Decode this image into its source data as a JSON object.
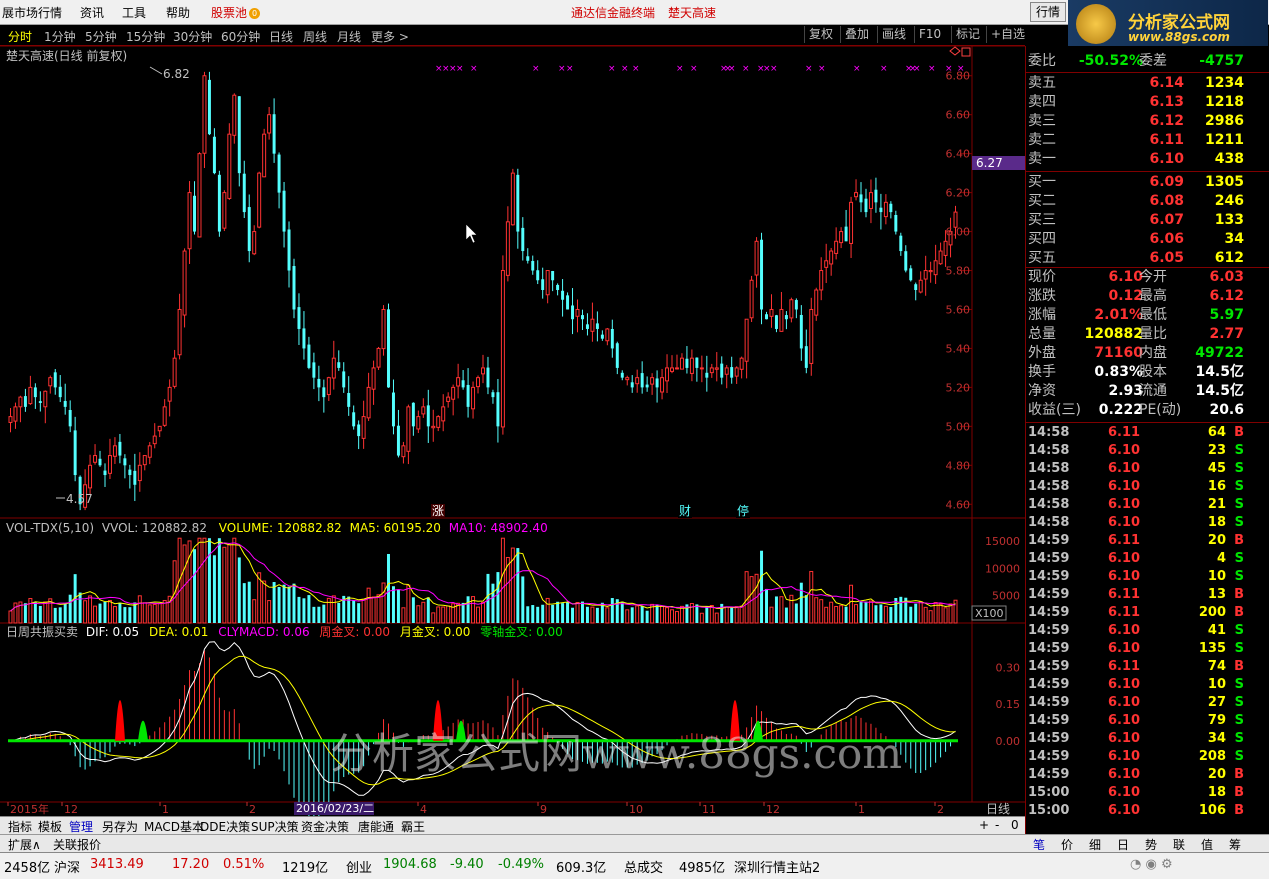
{
  "menu": {
    "items": [
      "展市场行情",
      "资讯",
      "工具",
      "帮助"
    ],
    "pool": "股票池",
    "pool_badge": "0",
    "center_title": "通达信金融终端",
    "stock_name": "楚天高速",
    "quote_button": "行情"
  },
  "logo": {
    "text": "分析家公式网",
    "url": "www.88gs.com"
  },
  "periods": [
    "分时",
    "1分钟",
    "5分钟",
    "15分钟",
    "30分钟",
    "60分钟",
    "日线",
    "周线",
    "月线",
    "更多"
  ],
  "active_period": "分时",
  "toolbar": [
    "复权",
    "叠加",
    "画线",
    "F10",
    "标记",
    "+自选"
  ],
  "main_chart": {
    "title": "楚天高速(日线 前复权)",
    "high_label": "6.82",
    "low_label": "4.57",
    "current_price_tag": "6.27",
    "y_ticks": [
      "6.80",
      "6.60",
      "6.40",
      "6.20",
      "6.00",
      "5.80",
      "5.60",
      "5.40",
      "5.20",
      "5.00",
      "4.80",
      "4.60"
    ],
    "markers": [
      {
        "text": "涨",
        "color": "#ffffff"
      },
      {
        "text": "财",
        "color": "#54ffff"
      },
      {
        "text": "停",
        "color": "#54ffff"
      }
    ]
  },
  "vol_chart": {
    "title": "VOL-TDX(5,10)",
    "vvol": "VVOL: 120882.82",
    "volume": "VOLUME: 120882.82",
    "ma5": "MA5: 60195.20",
    "ma10": "MA10: 48902.40",
    "y_ticks": [
      "15000",
      "10000",
      "5000"
    ],
    "unit": "X100"
  },
  "macd_chart": {
    "title": "日周共振买卖",
    "dif": "DIF: 0.05",
    "dea": "DEA: 0.01",
    "clymacd": "CLYMACD: 0.06",
    "week_cross": "周金叉: 0.00",
    "month_cross": "月金叉: 0.00",
    "zero_cross": "零轴金叉: 0.00",
    "y_ticks": [
      "0.30",
      "0.15",
      "0.00"
    ]
  },
  "date_axis": {
    "labels": [
      "2015年",
      "12",
      "1",
      "2",
      "4",
      "9",
      "10",
      "11",
      "12",
      "1",
      "2"
    ],
    "cursor_date": "2016/02/23/二",
    "period": "日线"
  },
  "order_book": {
    "weibi_label": "委比",
    "weibi": "-50.52%",
    "weicha_label": "委差",
    "weicha": "-4757",
    "asks": [
      {
        "label": "卖五",
        "price": "6.14",
        "vol": "1234"
      },
      {
        "label": "卖四",
        "price": "6.13",
        "vol": "1218"
      },
      {
        "label": "卖三",
        "price": "6.12",
        "vol": "2986"
      },
      {
        "label": "卖二",
        "price": "6.11",
        "vol": "1211"
      },
      {
        "label": "卖一",
        "price": "6.10",
        "vol": "438"
      }
    ],
    "bids": [
      {
        "label": "买一",
        "price": "6.09",
        "vol": "1305"
      },
      {
        "label": "买二",
        "price": "6.08",
        "vol": "246"
      },
      {
        "label": "买三",
        "price": "6.07",
        "vol": "133"
      },
      {
        "label": "买四",
        "price": "6.06",
        "vol": "34"
      },
      {
        "label": "买五",
        "price": "6.05",
        "vol": "612"
      }
    ]
  },
  "quote": [
    {
      "l1": "现价",
      "v1": "6.10",
      "c1": "red",
      "l2": "今开",
      "v2": "6.03",
      "c2": "red"
    },
    {
      "l1": "涨跌",
      "v1": "0.12",
      "c1": "red",
      "l2": "最高",
      "v2": "6.12",
      "c2": "red"
    },
    {
      "l1": "涨幅",
      "v1": "2.01%",
      "c1": "red",
      "l2": "最低",
      "v2": "5.97",
      "c2": "green"
    },
    {
      "l1": "总量",
      "v1": "120882",
      "c1": "yellow",
      "l2": "量比",
      "v2": "2.77",
      "c2": "red"
    },
    {
      "l1": "外盘",
      "v1": "71160",
      "c1": "red",
      "l2": "内盘",
      "v2": "49722",
      "c2": "green"
    },
    {
      "l1": "换手",
      "v1": "0.83%",
      "c1": "white",
      "l2": "股本",
      "v2": "14.5亿",
      "c2": "white"
    },
    {
      "l1": "净资",
      "v1": "2.93",
      "c1": "white",
      "l2": "流通",
      "v2": "14.5亿",
      "c2": "white"
    },
    {
      "l1": "收益(三)",
      "v1": "0.222",
      "c1": "white",
      "l2": "PE(动)",
      "v2": "20.6",
      "c2": "white"
    }
  ],
  "ticks": [
    {
      "t": "14:58",
      "p": "6.11",
      "v": "64",
      "bs": "B"
    },
    {
      "t": "14:58",
      "p": "6.10",
      "v": "23",
      "bs": "S"
    },
    {
      "t": "14:58",
      "p": "6.10",
      "v": "45",
      "bs": "S"
    },
    {
      "t": "14:58",
      "p": "6.10",
      "v": "16",
      "bs": "S"
    },
    {
      "t": "14:58",
      "p": "6.10",
      "v": "21",
      "bs": "S"
    },
    {
      "t": "14:58",
      "p": "6.10",
      "v": "18",
      "bs": "S"
    },
    {
      "t": "14:59",
      "p": "6.11",
      "v": "20",
      "bs": "B"
    },
    {
      "t": "14:59",
      "p": "6.10",
      "v": "4",
      "bs": "S"
    },
    {
      "t": "14:59",
      "p": "6.10",
      "v": "10",
      "bs": "S"
    },
    {
      "t": "14:59",
      "p": "6.11",
      "v": "13",
      "bs": "B"
    },
    {
      "t": "14:59",
      "p": "6.11",
      "v": "200",
      "bs": "B"
    },
    {
      "t": "14:59",
      "p": "6.10",
      "v": "41",
      "bs": "S"
    },
    {
      "t": "14:59",
      "p": "6.10",
      "v": "135",
      "bs": "S"
    },
    {
      "t": "14:59",
      "p": "6.11",
      "v": "74",
      "bs": "B"
    },
    {
      "t": "14:59",
      "p": "6.10",
      "v": "10",
      "bs": "S"
    },
    {
      "t": "14:59",
      "p": "6.10",
      "v": "27",
      "bs": "S"
    },
    {
      "t": "14:59",
      "p": "6.10",
      "v": "79",
      "bs": "S"
    },
    {
      "t": "14:59",
      "p": "6.10",
      "v": "34",
      "bs": "S"
    },
    {
      "t": "14:59",
      "p": "6.10",
      "v": "208",
      "bs": "S"
    },
    {
      "t": "14:59",
      "p": "6.10",
      "v": "20",
      "bs": "B"
    },
    {
      "t": "15:00",
      "p": "6.10",
      "v": "18",
      "bs": "B"
    },
    {
      "t": "15:00",
      "p": "6.10",
      "v": "106",
      "bs": "B"
    }
  ],
  "bottom_tabs": [
    "指标",
    "模板",
    "管理",
    "另存为",
    "MACD基本",
    "DDE决策",
    "SUP决策",
    "资金决策",
    "唐能通",
    "霸王"
  ],
  "active_bottom_tab": "管理",
  "zoom_controls": [
    "+",
    "-",
    "0"
  ],
  "ext_tabs": [
    "扩展∧",
    "关联报价"
  ],
  "right_tabs": [
    "笔",
    "价",
    "细",
    "日",
    "势",
    "联",
    "值",
    "筹"
  ],
  "active_right_tab": "笔",
  "status": {
    "a_amount": "2458亿",
    "sh_label": "沪深",
    "sh_index": "3413.49",
    "sh_change": "17.20",
    "sh_pct": "0.51%",
    "sh_amount": "1219亿",
    "cy_label": "创业",
    "cy_index": "1904.68",
    "cy_change": "-9.40",
    "cy_pct": "-0.49%",
    "cy_amount": "609.3亿",
    "total_label": "总成交",
    "total": "4985亿",
    "server": "深圳行情主站2"
  },
  "watermark": "分析家公式网www.88gs.com",
  "chart_data": {
    "type": "candlestick",
    "title": "楚天高速(日线 前复权)",
    "ylim": [
      4.55,
      6.85
    ],
    "high": 6.82,
    "low": 4.57,
    "last_close": 6.1,
    "ohlc_close": [
      5.05,
      5.1,
      5.15,
      5.1,
      5.2,
      5.15,
      5.12,
      5.18,
      5.25,
      5.2,
      5.15,
      5.1,
      5.0,
      4.75,
      4.6,
      4.7,
      4.8,
      4.85,
      4.8,
      4.75,
      4.85,
      4.9,
      4.85,
      4.8,
      4.75,
      4.7,
      4.8,
      4.85,
      4.9,
      4.95,
      5.0,
      5.1,
      5.2,
      5.35,
      5.6,
      5.9,
      6.2,
      6.0,
      6.4,
      6.8,
      6.5,
      6.3,
      6.0,
      6.2,
      6.5,
      6.7,
      6.3,
      6.1,
      5.9,
      6.0,
      6.3,
      6.5,
      6.6,
      6.4,
      6.2,
      6.0,
      5.8,
      5.6,
      5.5,
      5.4,
      5.3,
      5.25,
      5.2,
      5.15,
      5.25,
      5.35,
      5.3,
      5.2,
      5.1,
      5.0,
      4.95,
      5.05,
      5.2,
      5.3,
      5.4,
      5.6,
      5.2,
      5.0,
      4.85,
      4.9,
      5.1,
      5.0,
      5.05,
      5.1,
      5.0,
      5.0,
      5.05,
      5.1,
      5.15,
      5.2,
      5.25,
      5.2,
      5.1,
      5.2,
      5.25,
      5.3,
      5.2,
      5.15,
      5.0,
      5.8,
      6.05,
      6.3,
      6.0,
      5.9,
      5.85,
      5.8,
      5.75,
      5.7,
      5.8,
      5.75,
      5.7,
      5.65,
      5.6,
      5.55,
      5.6,
      5.55,
      5.5,
      5.55,
      5.5,
      5.45,
      5.5,
      5.4,
      5.3,
      5.25,
      5.25,
      5.2,
      5.25,
      5.2,
      5.2,
      5.25,
      5.2,
      5.25,
      5.3,
      5.3,
      5.3,
      5.35,
      5.3,
      5.35,
      5.3,
      5.3,
      5.25,
      5.3,
      5.3,
      5.25,
      5.3,
      5.25,
      5.3,
      5.35,
      5.55,
      5.75,
      5.95,
      5.6,
      5.55,
      5.6,
      5.5,
      5.6,
      5.55,
      5.65,
      5.6,
      5.4,
      5.3,
      5.6,
      5.7,
      5.8,
      5.85,
      5.9,
      5.95,
      6.0,
      5.95,
      6.15,
      6.2,
      6.15,
      6.1,
      6.2,
      6.15,
      6.1,
      6.15,
      6.1,
      6.0,
      5.9,
      5.8,
      5.75,
      5.7,
      5.75,
      5.8,
      5.8,
      5.85,
      5.9,
      5.95,
      6.0,
      6.1
    ],
    "volume_ylim": [
      0,
      17000
    ],
    "volume_ticks": [
      15000,
      10000,
      5000
    ],
    "macd_ylim": [
      -0.25,
      0.42
    ],
    "macd_ticks": [
      0.3,
      0.15,
      0.0
    ]
  }
}
